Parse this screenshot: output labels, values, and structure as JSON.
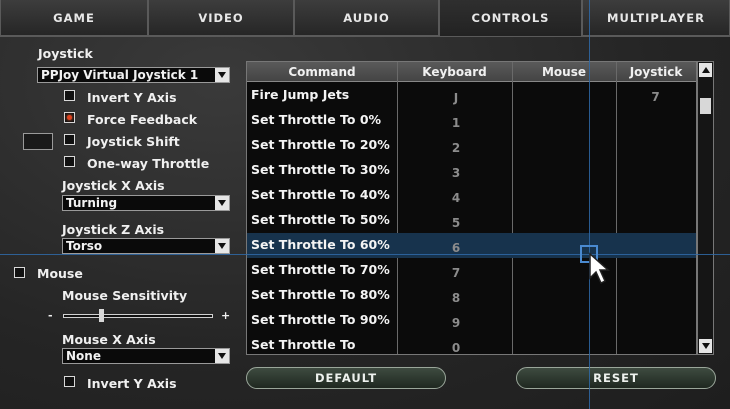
{
  "tabs": [
    {
      "label": "GAME",
      "active": false
    },
    {
      "label": "VIDEO",
      "active": false
    },
    {
      "label": "AUDIO",
      "active": false
    },
    {
      "label": "CONTROLS",
      "active": true
    },
    {
      "label": "MULTIPLAYER",
      "active": false
    }
  ],
  "joystick": {
    "heading": "Joystick",
    "device": "PPJoy Virtual Joystick 1",
    "invert_y": {
      "label": "Invert Y Axis",
      "checked": false
    },
    "force_feedback": {
      "label": "Force Feedback",
      "checked": true
    },
    "shift": {
      "label": "Joystick Shift",
      "checked": false
    },
    "one_way": {
      "label": "One-way Throttle",
      "checked": false
    },
    "x_axis": {
      "label": "Joystick X Axis",
      "value": "Turning"
    },
    "z_axis": {
      "label": "Joystick Z Axis",
      "value": "Torso"
    }
  },
  "mouse": {
    "label": "Mouse",
    "checked": false,
    "sensitivity": {
      "label": "Mouse Sensitivity",
      "min": "-",
      "max": "+",
      "level": 0.24
    },
    "x_axis": {
      "label": "Mouse X Axis",
      "value": "None"
    },
    "invert_y": {
      "label": "Invert Y Axis",
      "checked": false
    }
  },
  "table": {
    "headers": [
      "Command",
      "Keyboard",
      "Mouse",
      "Joystick"
    ],
    "selected_index": 6,
    "rows": [
      {
        "command": "Fire Jump Jets",
        "keyboard": "J",
        "mouse": "",
        "joystick": "7"
      },
      {
        "command": "Set Throttle To 0%",
        "keyboard": "1",
        "mouse": "",
        "joystick": ""
      },
      {
        "command": "Set Throttle To 20%",
        "keyboard": "2",
        "mouse": "",
        "joystick": ""
      },
      {
        "command": "Set Throttle To 30%",
        "keyboard": "3",
        "mouse": "",
        "joystick": ""
      },
      {
        "command": "Set Throttle To 40%",
        "keyboard": "4",
        "mouse": "",
        "joystick": ""
      },
      {
        "command": "Set Throttle To 50%",
        "keyboard": "5",
        "mouse": "",
        "joystick": ""
      },
      {
        "command": "Set Throttle To 60%",
        "keyboard": "6",
        "mouse": "",
        "joystick": ""
      },
      {
        "command": "Set Throttle To 70%",
        "keyboard": "7",
        "mouse": "",
        "joystick": ""
      },
      {
        "command": "Set Throttle To 80%",
        "keyboard": "8",
        "mouse": "",
        "joystick": ""
      },
      {
        "command": "Set Throttle To 90%",
        "keyboard": "9",
        "mouse": "",
        "joystick": ""
      },
      {
        "command": "Set Throttle To",
        "keyboard": "0",
        "mouse": "",
        "joystick": ""
      }
    ]
  },
  "buttons": {
    "default": "DEFAULT",
    "reset": "RESET"
  },
  "icons": {
    "dropdown": "chevron-down-icon",
    "scroll_up": "scroll-up-icon",
    "scroll_down": "scroll-down-icon"
  },
  "colors": {
    "selection": "#17334d",
    "checkbox_on": "#e04420",
    "crosshair": "#2f6aa8"
  }
}
